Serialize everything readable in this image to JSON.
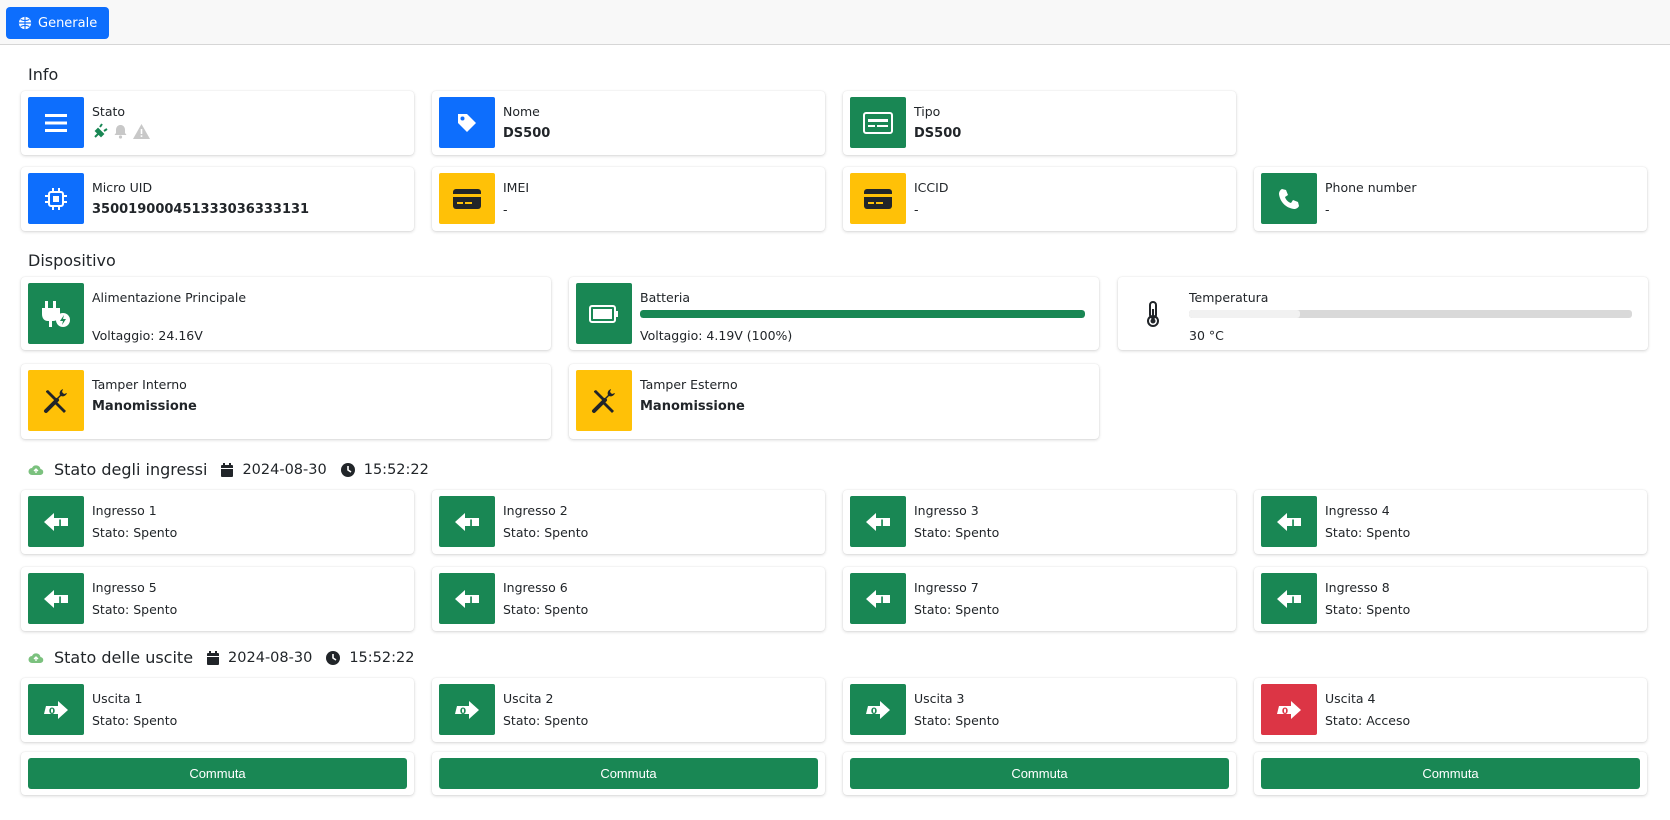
{
  "header": {
    "tab_label": "Generale"
  },
  "sections": {
    "info": "Info",
    "dispositivo": "Dispositivo",
    "ingressi": {
      "title": "Stato degli ingressi",
      "date": "2024-08-30",
      "time": "15:52:22"
    },
    "uscite": {
      "title": "Stato delle uscite",
      "date": "2024-08-30",
      "time": "15:52:22"
    }
  },
  "info": {
    "stato": {
      "label": "Stato",
      "icons": [
        "plug-bolt-icon",
        "bell-icon",
        "warning-icon"
      ]
    },
    "nome": {
      "label": "Nome",
      "value": "DS500"
    },
    "tipo": {
      "label": "Tipo",
      "value": "DS500"
    },
    "micro_uid": {
      "label": "Micro UID",
      "value": "35001900045133303633313​1"
    },
    "imei": {
      "label": "IMEI",
      "value": "-"
    },
    "iccid": {
      "label": "ICCID",
      "value": "-"
    },
    "phone": {
      "label": "Phone number",
      "value": "-"
    }
  },
  "device": {
    "alimentazione": {
      "label": "Alimentazione Principale",
      "value": "Voltaggio: 24.16V"
    },
    "batteria": {
      "label": "Batteria",
      "value": "Voltaggio: 4.19V (100%)",
      "level_percent": 100
    },
    "temperatura": {
      "label": "Temperatura",
      "value": "30 °C",
      "level_percent": 25
    },
    "tamper_interno": {
      "label": "Tamper Interno",
      "value": "Manomissione"
    },
    "tamper_esterno": {
      "label": "Tamper Esterno",
      "value": "Manomissione"
    }
  },
  "inputs": [
    {
      "label": "Ingresso 1",
      "status": "Stato: Spento"
    },
    {
      "label": "Ingresso 2",
      "status": "Stato: Spento"
    },
    {
      "label": "Ingresso 3",
      "status": "Stato: Spento"
    },
    {
      "label": "Ingresso 4",
      "status": "Stato: Spento"
    },
    {
      "label": "Ingresso 5",
      "status": "Stato: Spento"
    },
    {
      "label": "Ingresso 6",
      "status": "Stato: Spento"
    },
    {
      "label": "Ingresso 7",
      "status": "Stato: Spento"
    },
    {
      "label": "Ingresso 8",
      "status": "Stato: Spento"
    }
  ],
  "outputs": [
    {
      "label": "Uscita 1",
      "status": "Stato: Spento",
      "on": false
    },
    {
      "label": "Uscita 2",
      "status": "Stato: Spento",
      "on": false
    },
    {
      "label": "Uscita 3",
      "status": "Stato: Spento",
      "on": false
    },
    {
      "label": "Uscita 4",
      "status": "Stato: Acceso",
      "on": true
    }
  ],
  "actions": {
    "toggle_label": "Commuta"
  },
  "colors": {
    "primary": "#0d6efd",
    "success": "#198754",
    "warning": "#ffc107",
    "danger": "#dc3545",
    "cloud": "#7bc17e"
  }
}
